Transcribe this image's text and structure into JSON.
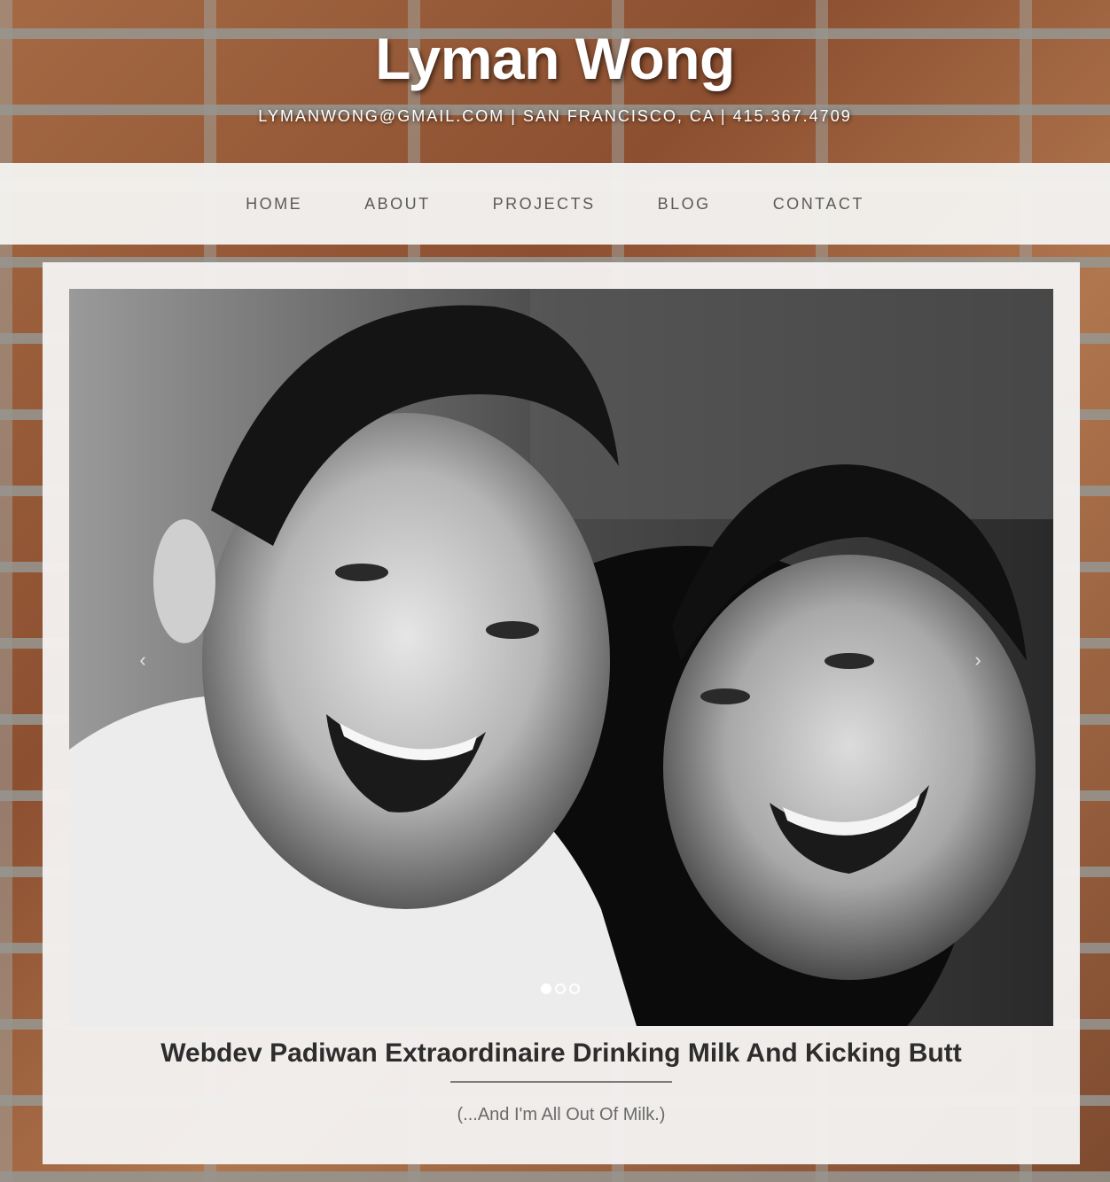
{
  "header": {
    "title": "Lyman Wong",
    "contact": "LYMANWONG@GMAIL.COM | SAN FRANCISCO, CA | 415.367.4709"
  },
  "nav": {
    "items": [
      {
        "label": "HOME"
      },
      {
        "label": "ABOUT"
      },
      {
        "label": "PROJECTS"
      },
      {
        "label": "BLOG"
      },
      {
        "label": "CONTACT"
      }
    ]
  },
  "carousel": {
    "prev_glyph": "‹",
    "next_glyph": "›",
    "slide_count": 3,
    "active_slide": 1
  },
  "hero": {
    "tagline": "Webdev Padiwan Extraordinaire Drinking Milk And Kicking Butt",
    "subtitle": "(...And I'm All Out Of Milk.)"
  },
  "colors": {
    "nav_bg": "#f4f2f0",
    "card_bg": "#f3f1ef",
    "nav_text": "#5a5a5a",
    "tagline_text": "#2d2d2d"
  }
}
